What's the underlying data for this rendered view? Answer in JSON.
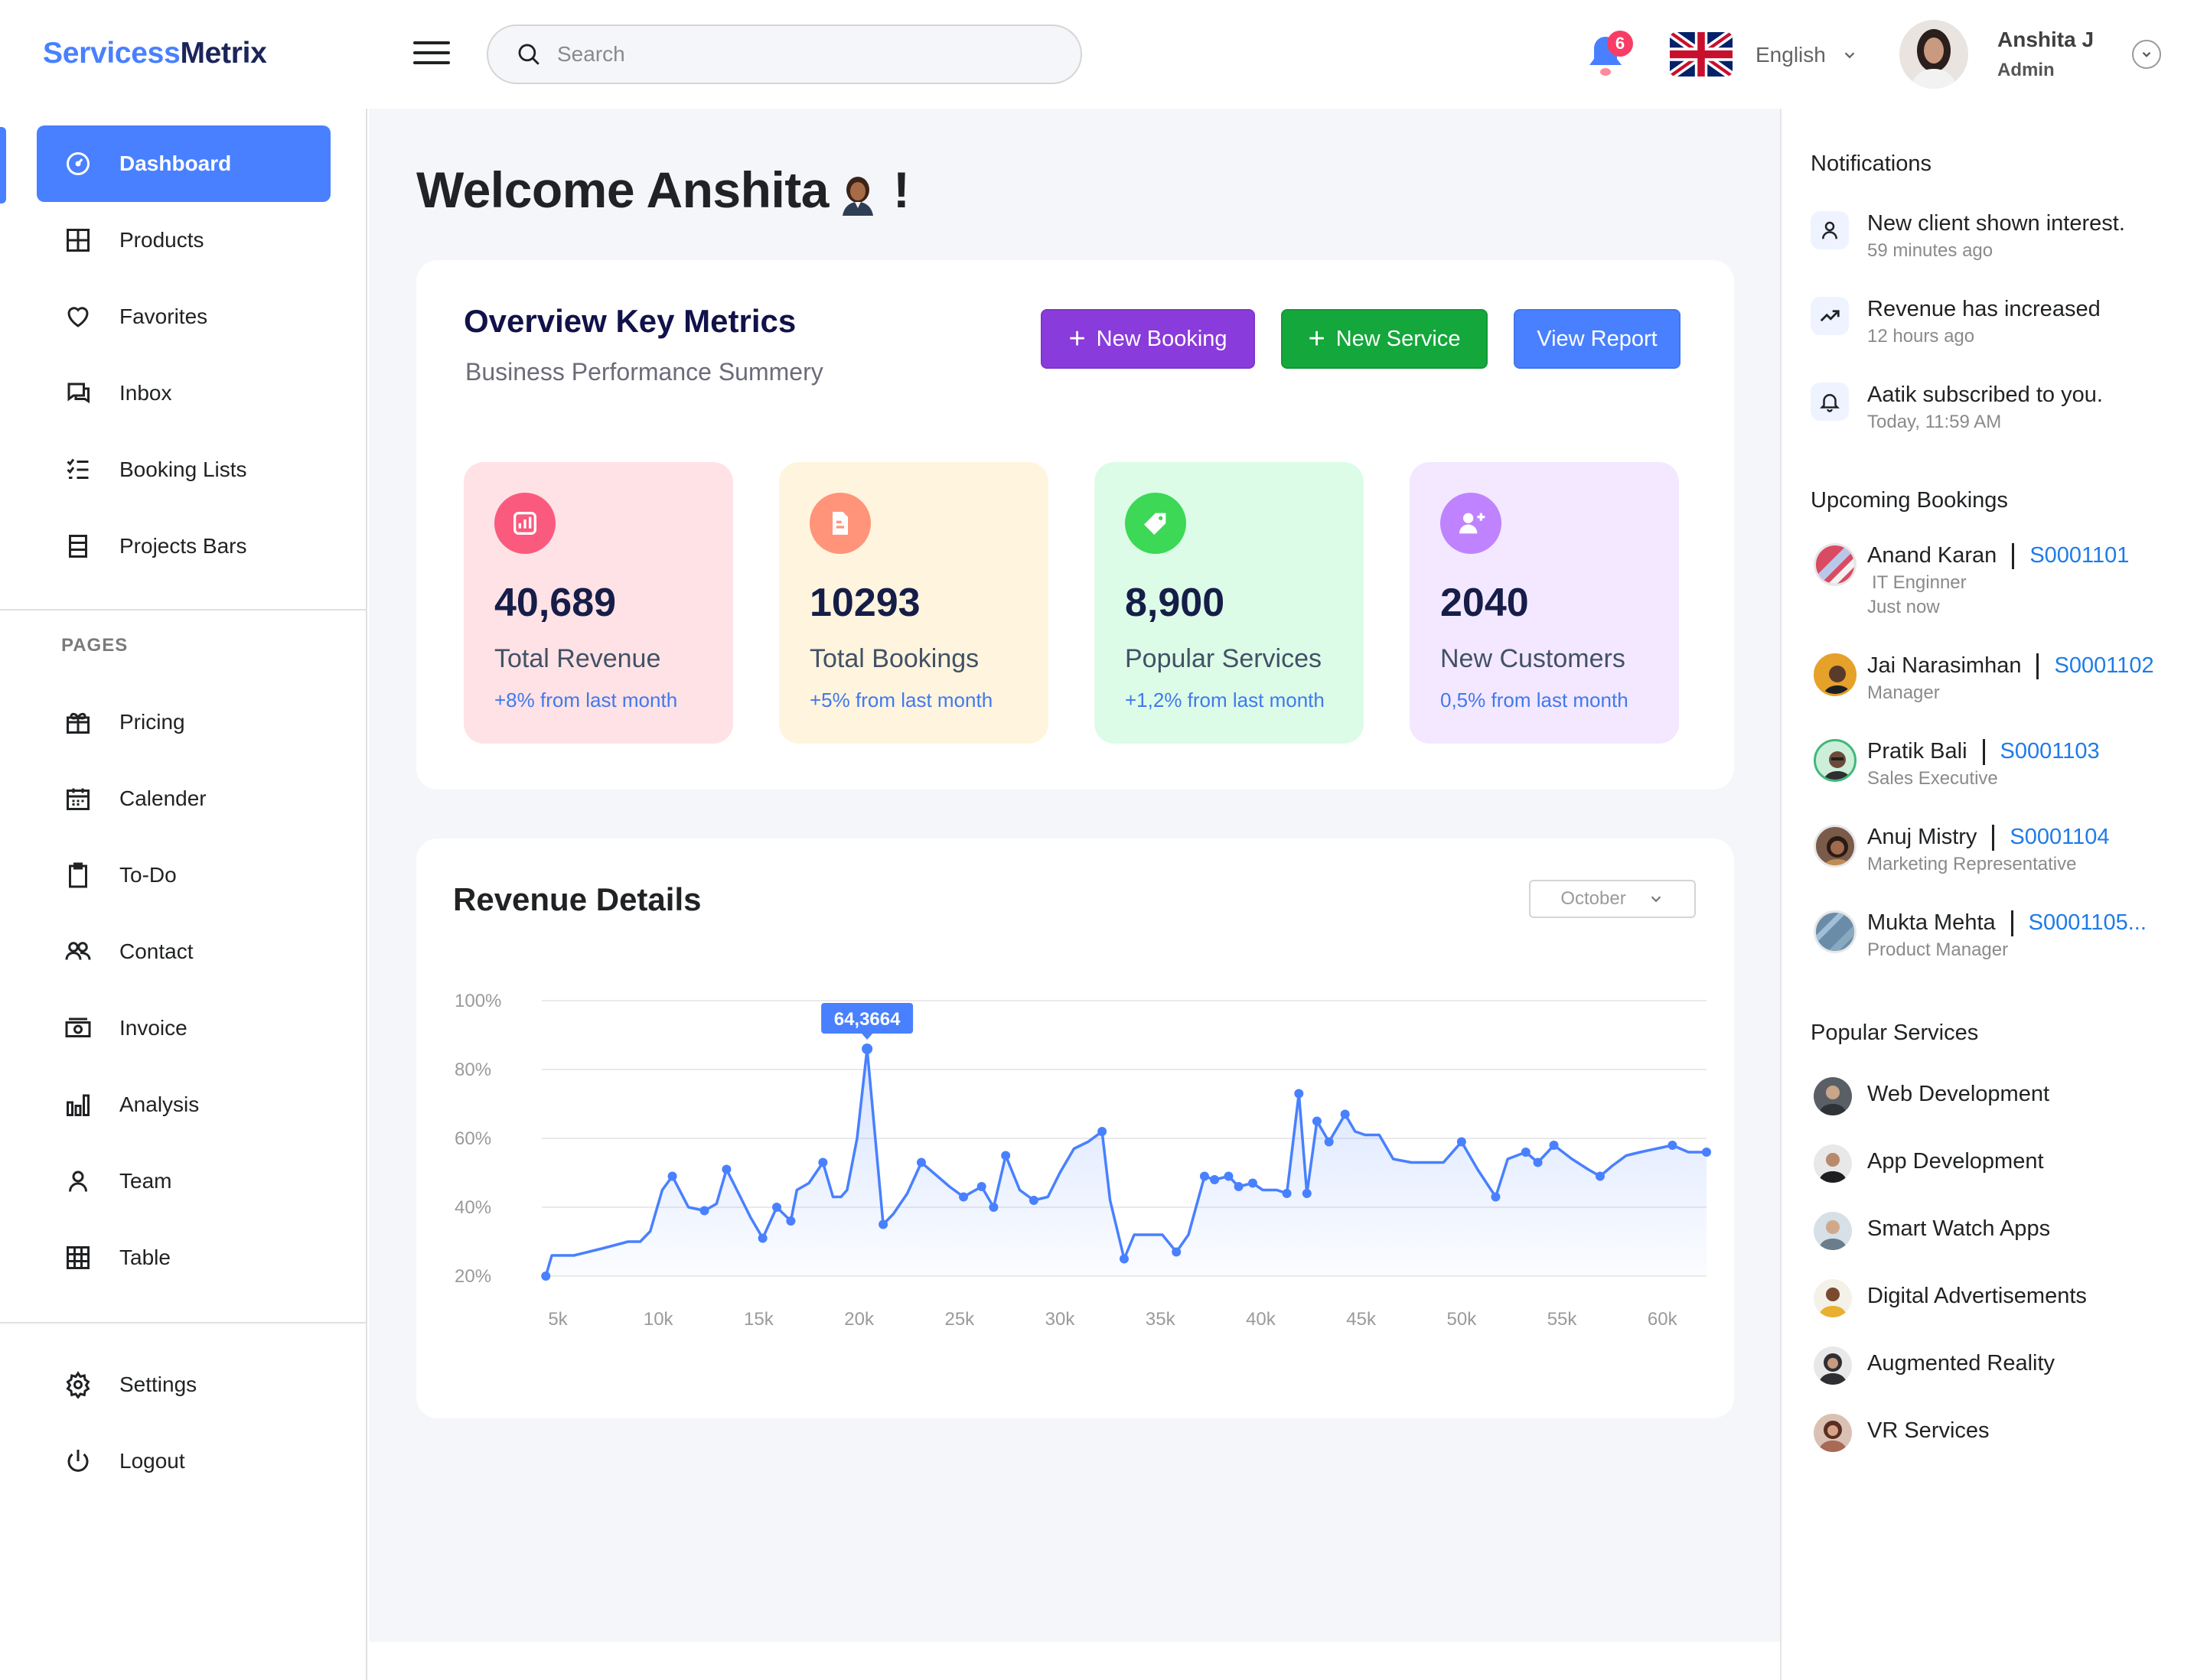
{
  "app": {
    "logo_part1": "Servicess",
    "logo_part2": "Metrix"
  },
  "header": {
    "search_placeholder": "Search",
    "notification_count": "6",
    "language": "English",
    "user_name": "Anshita J",
    "user_role": "Admin"
  },
  "sidebar": {
    "items": [
      {
        "label": "Dashboard",
        "icon": "dashboard-icon"
      },
      {
        "label": "Products",
        "icon": "grid-icon"
      },
      {
        "label": "Favorites",
        "icon": "heart-icon"
      },
      {
        "label": "Inbox",
        "icon": "chat-icon"
      },
      {
        "label": "Booking Lists",
        "icon": "list-icon"
      },
      {
        "label": "Projects Bars",
        "icon": "bars-icon"
      }
    ],
    "pages_label": "PAGES",
    "pages": [
      {
        "label": "Pricing",
        "icon": "gift-icon"
      },
      {
        "label": "Calender",
        "icon": "calendar-icon"
      },
      {
        "label": "To-Do",
        "icon": "clipboard-icon"
      },
      {
        "label": "Contact",
        "icon": "users-icon"
      },
      {
        "label": "Invoice",
        "icon": "money-icon"
      },
      {
        "label": "Analysis",
        "icon": "analysis-icon"
      },
      {
        "label": "Team",
        "icon": "person-icon"
      },
      {
        "label": "Table",
        "icon": "table-icon"
      }
    ],
    "bottom": [
      {
        "label": "Settings",
        "icon": "gear-icon"
      },
      {
        "label": "Logout",
        "icon": "power-icon"
      }
    ]
  },
  "main": {
    "welcome_prefix": "Welcome Anshita",
    "welcome_suffix": "!",
    "overview": {
      "title": "Overview Key Metrics",
      "subtitle": "Business Performance Summery",
      "buttons": {
        "new_booking": "New Booking",
        "new_service": "New Service",
        "view_report": "View Report"
      },
      "metrics": [
        {
          "value": "40,689",
          "label": "Total Revenue",
          "change": "+8% from last month",
          "bg": "#FFE2E5",
          "icon_bg": "#FA5A7D"
        },
        {
          "value": "10293",
          "label": "Total Bookings",
          "change": "+5% from last month",
          "bg": "#FFF4DE",
          "icon_bg": "#FF947A"
        },
        {
          "value": "8,900",
          "label": "Popular Services",
          "change": "+1,2% from last month",
          "bg": "#DCFCE7",
          "icon_bg": "#3CD856"
        },
        {
          "value": "2040",
          "label": "New Customers",
          "change": "0,5% from last month",
          "bg": "#F3E8FF",
          "icon_bg": "#BF83FF"
        }
      ]
    },
    "revenue": {
      "title": "Revenue Details",
      "month": "October"
    }
  },
  "chart_data": {
    "type": "area",
    "title": "Revenue Details",
    "xlabel": "",
    "ylabel": "",
    "x_ticks": [
      "5k",
      "10k",
      "15k",
      "20k",
      "25k",
      "30k",
      "35k",
      "40k",
      "45k",
      "50k",
      "55k",
      "60k"
    ],
    "y_ticks": [
      "20%",
      "40%",
      "60%",
      "80%",
      "100%"
    ],
    "xlim": [
      4200,
      62200
    ],
    "ylim": [
      20,
      100
    ],
    "grid": true,
    "color": "#4880FF",
    "highlight": {
      "label": "64,3664",
      "x": 20400,
      "y": 86
    },
    "series": [
      {
        "x": [
          4400,
          4700,
          5800,
          6500,
          7200,
          8500,
          9100,
          9600,
          10200,
          10700,
          11500,
          12300,
          12900,
          13400,
          14000,
          14600,
          15200,
          15900,
          16600,
          16900,
          17500,
          18200,
          18700,
          19100,
          19400,
          19900,
          20400,
          21200,
          21700,
          22400,
          23100,
          23900,
          24500,
          25200,
          26100,
          26700,
          27300,
          28000,
          28700,
          29400,
          30000,
          30700,
          31400,
          32100,
          32500,
          33200,
          33700,
          34400,
          35100,
          35800,
          36400,
          37200,
          37700,
          38400,
          38900,
          39600,
          40100,
          40800,
          41300,
          41900,
          42300,
          42800,
          43400,
          44200,
          44700,
          45200,
          45900,
          46600,
          47500,
          48200,
          49100,
          50000,
          50800,
          51700,
          52300,
          53200,
          53800,
          54600,
          55500,
          56300,
          56900,
          57500,
          58200,
          58900,
          59700,
          60500,
          61300,
          61900,
          62200
        ],
        "y": [
          20,
          26,
          26,
          27,
          28,
          30,
          30,
          33,
          45,
          49,
          40,
          39,
          41,
          51,
          44,
          37,
          31,
          40,
          36,
          45,
          47,
          53,
          43,
          43,
          45,
          60,
          86,
          35,
          38,
          44,
          53,
          49,
          46,
          43,
          46,
          40,
          55,
          45,
          42,
          43,
          50,
          57,
          59,
          62,
          42,
          25,
          32,
          32,
          32,
          27,
          32,
          49,
          48,
          49,
          46,
          47,
          45,
          45,
          44,
          73,
          44,
          65,
          59,
          67,
          62,
          61,
          61,
          54,
          53,
          53,
          53,
          59,
          51,
          43,
          54,
          56,
          53,
          58,
          54,
          51,
          49,
          52,
          55,
          56,
          57,
          58,
          56,
          56,
          56
        ]
      }
    ]
  },
  "right_panel": {
    "notifications_title": "Notifications",
    "notifications": [
      {
        "title": "New client shown interest.",
        "time": "59 minutes ago",
        "icon": "user-icon"
      },
      {
        "title": "Revenue has increased",
        "time": "12 hours ago",
        "icon": "trend-up-icon"
      },
      {
        "title": "Aatik subscribed to you.",
        "time": "Today, 11:59 AM",
        "icon": "bell-icon"
      }
    ],
    "bookings_title": "Upcoming Bookings",
    "bookings": [
      {
        "name": "Anand Karan",
        "code": "S0001101",
        "role": "IT Enginner",
        "time": "Just now",
        "color": "#D94B63"
      },
      {
        "name": "Jai Narasimhan",
        "code": "S0001102",
        "role": "Manager",
        "color": "#E5A12A"
      },
      {
        "name": "Pratik Bali",
        "code": "S0001103",
        "role": "Sales Executive",
        "color": "#3FB97A"
      },
      {
        "name": "Anuj Mistry",
        "code": "S0001104",
        "role": "Marketing Representative",
        "color": "#7A5B4A"
      },
      {
        "name": "Mukta Mehta",
        "code": "S0001105...",
        "role": "Product Manager",
        "color": "#6A8CA8"
      }
    ],
    "services_title": "Popular Services",
    "services": [
      {
        "name": "Web Development",
        "color": "#5A5F66"
      },
      {
        "name": "App Development",
        "color": "#3B3F45"
      },
      {
        "name": "Smart Watch Apps",
        "color": "#6B7C8A"
      },
      {
        "name": "Digital Advertisements",
        "color": "#E8B030"
      },
      {
        "name": "Augmented Reality",
        "color": "#2F2F33"
      },
      {
        "name": "VR Services",
        "color": "#A86A56"
      }
    ]
  }
}
